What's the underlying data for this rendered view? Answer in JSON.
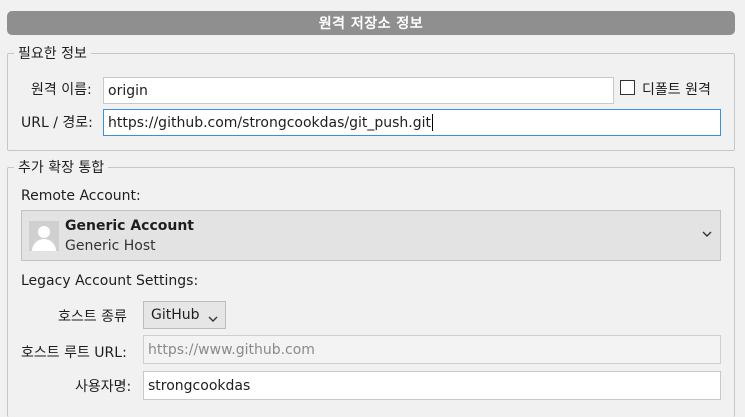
{
  "title": "원격 저장소 정보",
  "required_section": {
    "legend": "필요한 정보",
    "remote_name_label": "원격 이름:",
    "remote_name_value": "origin",
    "default_remote_label": "디폴트 원격",
    "url_label": "URL / 경로:",
    "url_value": "https://github.com/strongcookdas/git_push.git"
  },
  "extra_section": {
    "legend": "추가 확장 통합",
    "remote_account_label": "Remote Account:",
    "account": {
      "name": "Generic Account",
      "host": "Generic Host"
    },
    "legacy_label": "Legacy Account Settings:",
    "host_type_label": "호스트 종류",
    "host_type_value": "GitHub",
    "host_root_label": "호스트 루트 URL:",
    "host_root_placeholder": "https://www.github.com",
    "username_label": "사용자명:",
    "username_value": "strongcookdas"
  },
  "icons": {
    "dropdown": "chevron-down-icon",
    "avatar": "user-avatar-icon"
  }
}
